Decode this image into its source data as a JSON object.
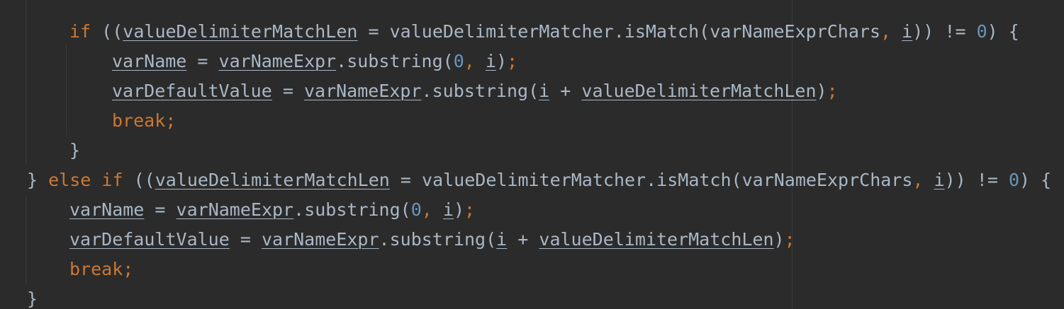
{
  "colors": {
    "background": "#2b2b2b",
    "default_text": "#a9b7c6",
    "keyword": "#cc7832",
    "number": "#6897bb",
    "indent_guide": "#3b3b3b"
  },
  "tokens": {
    "kw_if": "if",
    "kw_else": "else",
    "kw_break": "break",
    "open_paren": "(",
    "close_paren": ")",
    "open_brace": "{",
    "close_brace": "}",
    "assign": "=",
    "not_equal": "!=",
    "plus": "+",
    "dot": ".",
    "comma": ",",
    "semicolon": ";",
    "zero": "0",
    "value_delimiter_match_len": "valueDelimiterMatchLen",
    "value_delimiter_matcher": "valueDelimiterMatcher",
    "is_match": "isMatch",
    "var_name_expr_chars": "varNameExprChars",
    "var_name_expr": "varNameExpr",
    "var_name": "varName",
    "var_default_value": "varDefaultValue",
    "substring": "substring",
    "index_i": "i"
  }
}
